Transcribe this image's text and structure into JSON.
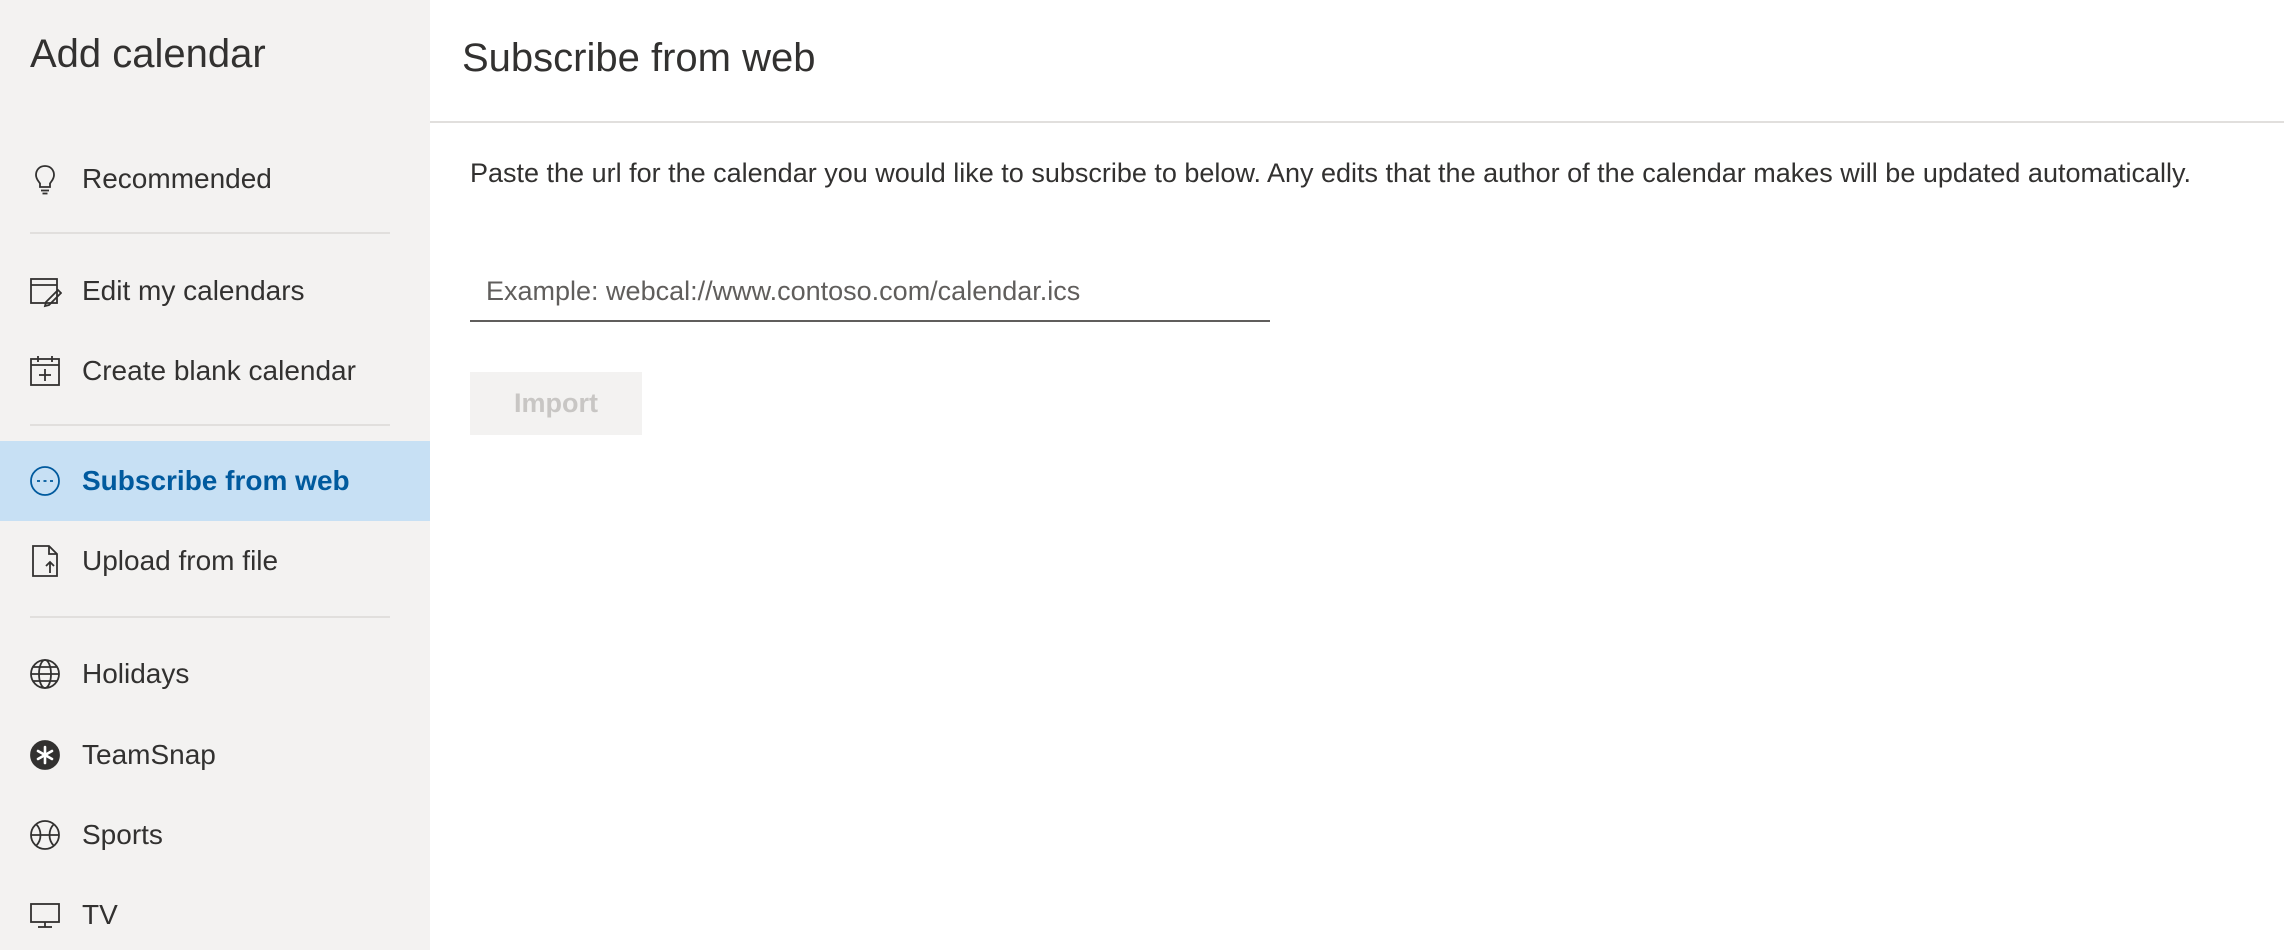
{
  "sidebar": {
    "title": "Add calendar",
    "items": [
      {
        "label": "Recommended",
        "icon": "lightbulb-icon"
      },
      {
        "label": "Edit my calendars",
        "icon": "edit-calendar-icon"
      },
      {
        "label": "Create blank calendar",
        "icon": "calendar-add-icon"
      },
      {
        "label": "Subscribe from web",
        "icon": "web-link-icon",
        "selected": true
      },
      {
        "label": "Upload from file",
        "icon": "file-upload-icon"
      },
      {
        "label": "Holidays",
        "icon": "globe-icon"
      },
      {
        "label": "TeamSnap",
        "icon": "teamsnap-icon"
      },
      {
        "label": "Sports",
        "icon": "sports-ball-icon"
      },
      {
        "label": "TV",
        "icon": "tv-icon"
      }
    ]
  },
  "main": {
    "title": "Subscribe from web",
    "description": "Paste the url for the calendar you would like to subscribe to below. Any edits that the author of the calendar makes will be updated automatically.",
    "url_input": {
      "placeholder": "Example: webcal://www.contoso.com/calendar.ics",
      "value": ""
    },
    "import_label": "Import",
    "import_disabled": true
  },
  "colors": {
    "sidebar_bg": "#f3f2f1",
    "selected_bg": "#c7e0f4",
    "accent": "#005a9e",
    "text": "#323130",
    "disabled_text": "#c8c6c4"
  }
}
